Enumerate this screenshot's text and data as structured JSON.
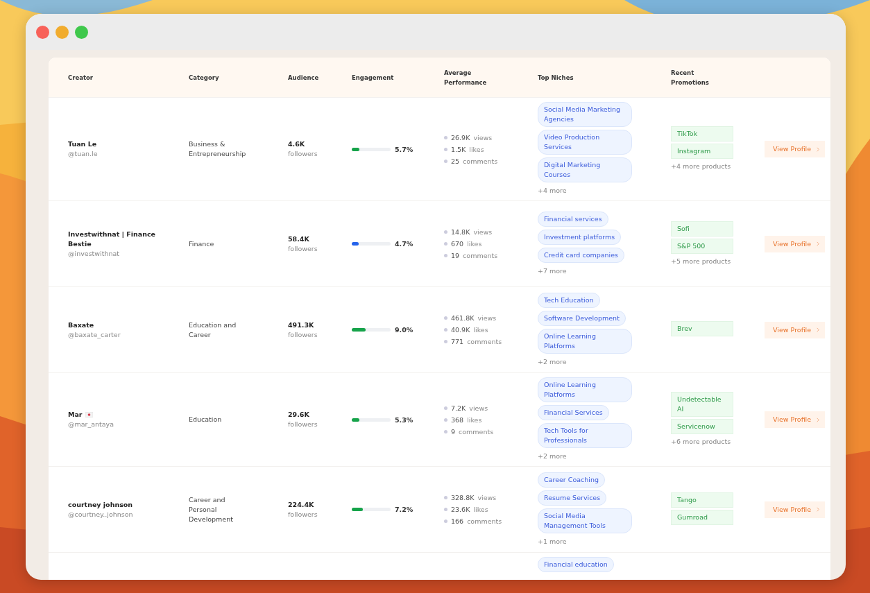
{
  "table": {
    "columns": [
      "Creator",
      "Category",
      "Audience",
      "Engagement",
      "Average Performance",
      "Top Niches",
      "Recent Promotions"
    ],
    "rows": [
      {
        "name": "Tuan Le",
        "flag": false,
        "handle": "@tuan.le",
        "category": "Business & Entrepreneurship",
        "audience": "4.6K",
        "audience_unit": "followers",
        "engagement": {
          "level": 0.2,
          "color": "#16a34a",
          "reading": "5.7%"
        },
        "performance": [
          {
            "value": "26.9K",
            "unit": "views"
          },
          {
            "value": "1.5K",
            "unit": "likes"
          },
          {
            "value": "25",
            "unit": "comments"
          }
        ],
        "niches": [
          "Social Media Marketing Agencies",
          "Video Production Services",
          "Digital Marketing Courses"
        ],
        "niches_more": "+4 more",
        "promotions": [
          "TikTok",
          "Instagram"
        ],
        "promotions_more": "+4 more products",
        "action": "View Profile"
      },
      {
        "name": "Investwithnat | Finance Bestie",
        "flag": false,
        "handle": "@investwithnat",
        "category": "Finance",
        "audience": "58.4K",
        "audience_unit": "followers",
        "engagement": {
          "level": 0.17,
          "color": "#2563eb",
          "reading": "4.7%"
        },
        "performance": [
          {
            "value": "14.8K",
            "unit": "views"
          },
          {
            "value": "670",
            "unit": "likes"
          },
          {
            "value": "19",
            "unit": "comments"
          }
        ],
        "niches": [
          "Financial services",
          "Investment platforms",
          "Credit card companies"
        ],
        "niches_more": "+7 more",
        "promotions": [
          "Sofi",
          "S&P 500"
        ],
        "promotions_more": "+5 more products",
        "action": "View Profile"
      },
      {
        "name": "Baxate",
        "flag": false,
        "handle": "@baxate_carter",
        "category": "Education and Career",
        "audience": "491.3K",
        "audience_unit": "followers",
        "engagement": {
          "level": 0.36,
          "color": "#16a34a",
          "reading": "9.0%"
        },
        "performance": [
          {
            "value": "461.8K",
            "unit": "views"
          },
          {
            "value": "40.9K",
            "unit": "likes"
          },
          {
            "value": "771",
            "unit": "comments"
          }
        ],
        "niches": [
          "Tech Education",
          "Software Development",
          "Online Learning Platforms"
        ],
        "niches_more": "+2 more",
        "promotions": [
          "Brev"
        ],
        "action": "View Profile"
      },
      {
        "name": "Mar",
        "flag": true,
        "handle": "@mar_antaya",
        "category": "Education",
        "audience": "29.6K",
        "audience_unit": "followers",
        "engagement": {
          "level": 0.2,
          "color": "#16a34a",
          "reading": "5.3%"
        },
        "performance": [
          {
            "value": "7.2K",
            "unit": "views"
          },
          {
            "value": "368",
            "unit": "likes"
          },
          {
            "value": "9",
            "unit": "comments"
          }
        ],
        "niches": [
          "Online Learning Platforms",
          "Financial Services",
          "Tech Tools for Professionals"
        ],
        "niches_more": "+2 more",
        "promotions": [
          "Undetectable AI",
          "Servicenow"
        ],
        "promotions_more": "+6 more products",
        "action": "View Profile"
      },
      {
        "name": "courtney johnson",
        "flag": false,
        "handle": "@courtney..johnson",
        "category": "Career and Personal Development",
        "audience": "224.4K",
        "audience_unit": "followers",
        "engagement": {
          "level": 0.29,
          "color": "#16a34a",
          "reading": "7.2%"
        },
        "performance": [
          {
            "value": "328.8K",
            "unit": "views"
          },
          {
            "value": "23.6K",
            "unit": "likes"
          },
          {
            "value": "166",
            "unit": "comments"
          }
        ],
        "niches": [
          "Career Coaching",
          "Resume Services",
          "Social Media Management Tools"
        ],
        "niches_more": "+1 more",
        "promotions": [
          "Tango",
          "Gumroad"
        ],
        "action": "View Profile"
      },
      {
        "niches": [
          "Financial education"
        ]
      }
    ]
  }
}
